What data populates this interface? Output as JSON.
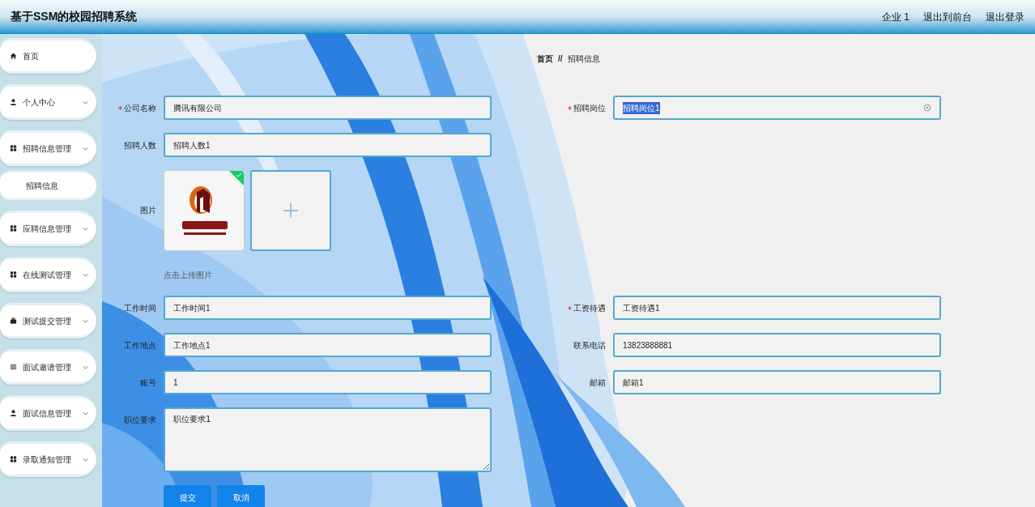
{
  "header": {
    "title": "基于SSM的校园招聘系统",
    "links": [
      "企业 1",
      "退出到前台",
      "退出登录"
    ]
  },
  "sidebar": {
    "items": [
      {
        "label": "首页",
        "expandable": false
      },
      {
        "label": "个人中心",
        "expandable": true
      },
      {
        "label": "招聘信息管理",
        "expandable": true,
        "children": [
          {
            "label": "招聘信息"
          }
        ]
      },
      {
        "label": "应聘信息管理",
        "expandable": true
      },
      {
        "label": "在线测试管理",
        "expandable": true
      },
      {
        "label": "测试提交管理",
        "expandable": true
      },
      {
        "label": "面试邀请管理",
        "expandable": true
      },
      {
        "label": "面试信息管理",
        "expandable": true
      },
      {
        "label": "录取通知管理",
        "expandable": true
      }
    ]
  },
  "breadcrumb": [
    "首页",
    "//",
    "招聘信息"
  ],
  "form_rows": [
    [
      {
        "kind": "text",
        "label": "公司名称",
        "required": true,
        "value": "腾讯有限公司"
      },
      {
        "kind": "text",
        "label": "招聘岗位",
        "required": true,
        "value": "招聘岗位1",
        "text_selected": true
      }
    ],
    [
      {
        "kind": "text",
        "label": "招聘人数",
        "required": false,
        "value": "招聘人数1"
      }
    ],
    [
      {
        "label": "图片",
        "required": false,
        "uploaded": true,
        "hint": "点击上传图片"
      }
    ],
    [
      {
        "kind": "text",
        "label": "工作时间",
        "required": false,
        "value": "工作时间1"
      },
      {
        "kind": "text",
        "label": "工资待遇",
        "required": true,
        "value": "工资待遇1"
      }
    ],
    [
      {
        "kind": "text",
        "label": "工作地点",
        "required": false,
        "value": "工作地点1"
      },
      {
        "kind": "text",
        "label": "联系电话",
        "required": false,
        "value": "13823888881"
      }
    ],
    [
      {
        "kind": "text",
        "label": "账号",
        "required": false,
        "value": "1"
      },
      {
        "kind": "text",
        "label": "邮箱",
        "required": false,
        "value": "邮箱1"
      }
    ],
    [
      {
        "kind": "textarea",
        "label": "职位要求",
        "required": false,
        "value": "职位要求1"
      }
    ]
  ],
  "buttons": [
    "提交",
    "取消"
  ]
}
